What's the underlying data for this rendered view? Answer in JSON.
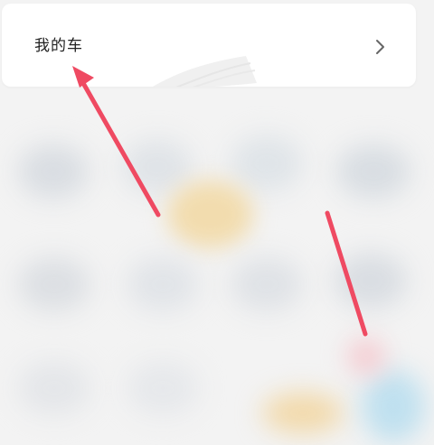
{
  "menu": {
    "label": "我的车"
  },
  "icons": {
    "chevron": "chevron-right-icon"
  },
  "colors": {
    "arrow": "#ef4a62",
    "card_background": "#ffffff",
    "page_background": "#f3f3f3"
  }
}
